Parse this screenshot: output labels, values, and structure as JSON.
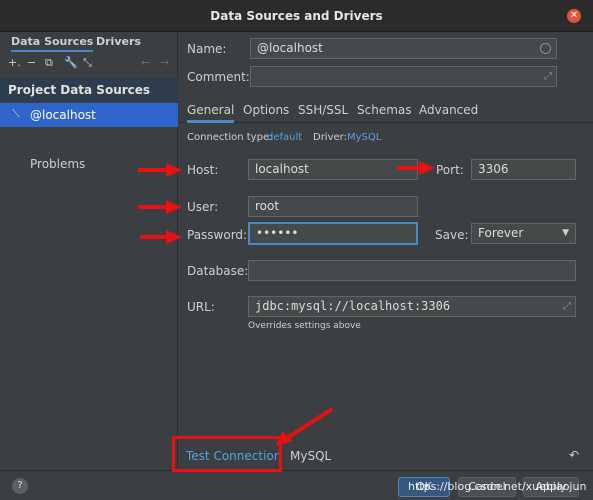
{
  "window": {
    "title": "Data Sources and Drivers"
  },
  "left": {
    "tabs": [
      "Data Sources",
      "Drivers"
    ],
    "toolbar_icons": [
      "add-icon",
      "remove-icon",
      "duplicate-icon",
      "wrench-icon",
      "chart-icon",
      "back-icon",
      "forward-icon"
    ],
    "section_title": "Project Data Sources",
    "selected_item": "@localhost",
    "problems_label": "Problems"
  },
  "form": {
    "name_label": "Name:",
    "name_value": "@localhost",
    "comment_label": "Comment:",
    "comment_value": "",
    "tabs": [
      "General",
      "Options",
      "SSH/SSL",
      "Schemas",
      "Advanced"
    ],
    "connection_type_label": "Connection type:",
    "connection_type_value": "default",
    "driver_label": "Driver:",
    "driver_value": "MySQL",
    "host_label": "Host:",
    "host_value": "localhost",
    "port_label": "Port:",
    "port_value": "3306",
    "user_label": "User:",
    "user_value": "root",
    "password_label": "Password:",
    "password_value": "••••••",
    "save_label": "Save:",
    "save_value": "Forever",
    "database_label": "Database:",
    "database_value": "",
    "url_label": "URL:",
    "url_value": "jdbc:mysql://localhost:3306",
    "url_hint": "Overrides settings above"
  },
  "bottom": {
    "test_connection": "Test Connection",
    "driver_tab": "MySQL"
  },
  "footer": {
    "help": "?",
    "ok": "OK",
    "cancel": "Cancel",
    "apply": "Apply",
    "watermark": "https://blog.csdn.net/xuebiaojun"
  },
  "colors": {
    "accent": "#4a88c7",
    "annotation": "#e81010",
    "selection": "#2f65ca"
  }
}
